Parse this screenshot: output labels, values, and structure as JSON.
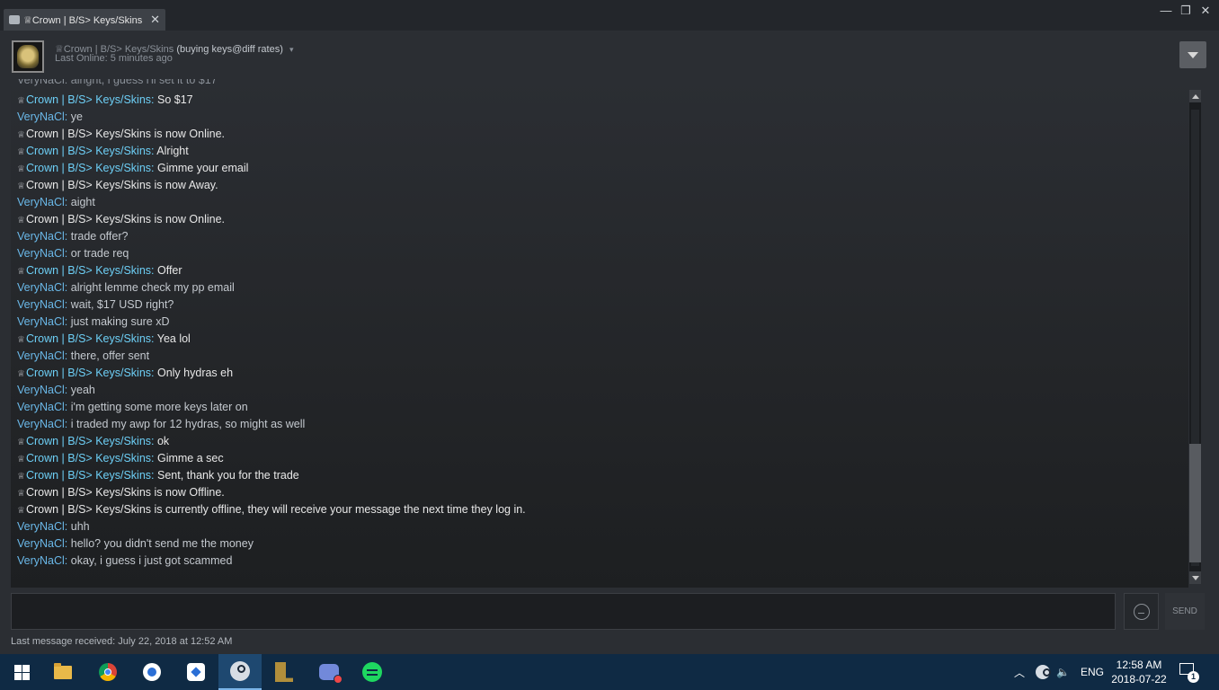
{
  "tab": {
    "title": "♕Crown | B/S> Keys/Skins",
    "close": "✕"
  },
  "window_controls": {
    "minimize": "—",
    "restore": "❐",
    "close": "✕"
  },
  "friend": {
    "name": "♕Crown | B/S> Keys/Skins",
    "extra": "(buying keys@diff rates)",
    "caret": "▾",
    "status": "Last Online: 5 minutes ago"
  },
  "chat": {
    "cut_line": "VeryNaCl: alright, i guess i'll set it to $17",
    "messages": [
      {
        "type": "friend",
        "name": "Crown | B/S> Keys/Skins",
        "text": "So $17"
      },
      {
        "type": "me",
        "name": "VeryNaCl",
        "text": "ye"
      },
      {
        "type": "status",
        "text": "Crown | B/S> Keys/Skins is now Online."
      },
      {
        "type": "friend",
        "name": "Crown | B/S> Keys/Skins",
        "text": "Alright"
      },
      {
        "type": "friend",
        "name": "Crown | B/S> Keys/Skins",
        "text": "Gimme your email"
      },
      {
        "type": "status",
        "text": "Crown | B/S> Keys/Skins is now Away."
      },
      {
        "type": "me",
        "name": "VeryNaCl",
        "text": "aight"
      },
      {
        "type": "status",
        "text": "Crown | B/S> Keys/Skins is now Online."
      },
      {
        "type": "me",
        "name": "VeryNaCl",
        "text": "trade offer?"
      },
      {
        "type": "me",
        "name": "VeryNaCl",
        "text": "or trade req"
      },
      {
        "type": "friend",
        "name": "Crown | B/S> Keys/Skins",
        "text": "Offer"
      },
      {
        "type": "me",
        "name": "VeryNaCl",
        "text": "alright lemme check my pp email"
      },
      {
        "type": "me",
        "name": "VeryNaCl",
        "text": "wait, $17 USD right?"
      },
      {
        "type": "me",
        "name": "VeryNaCl",
        "text": "just making sure xD"
      },
      {
        "type": "friend",
        "name": "Crown | B/S> Keys/Skins",
        "text": "Yea lol"
      },
      {
        "type": "me",
        "name": "VeryNaCl",
        "text": "there, offer sent"
      },
      {
        "type": "friend",
        "name": "Crown | B/S> Keys/Skins",
        "text": "Only hydras eh"
      },
      {
        "type": "me",
        "name": "VeryNaCl",
        "text": "yeah"
      },
      {
        "type": "me",
        "name": "VeryNaCl",
        "text": "i'm getting some more keys later on"
      },
      {
        "type": "me",
        "name": "VeryNaCl",
        "text": "i traded my awp for 12 hydras, so might as well"
      },
      {
        "type": "friend",
        "name": "Crown | B/S> Keys/Skins",
        "text": "ok"
      },
      {
        "type": "friend",
        "name": "Crown | B/S> Keys/Skins",
        "text": "Gimme a sec"
      },
      {
        "type": "friend",
        "name": "Crown | B/S> Keys/Skins",
        "text": "Sent, thank you for the trade"
      },
      {
        "type": "status",
        "text": "Crown | B/S> Keys/Skins is now Offline."
      },
      {
        "type": "status",
        "text": "Crown | B/S> Keys/Skins is currently offline, they will receive your message the next time they log in."
      },
      {
        "type": "me",
        "name": "VeryNaCl",
        "text": "uhh"
      },
      {
        "type": "me",
        "name": "VeryNaCl",
        "text": "hello? you didn't send me the money"
      },
      {
        "type": "me",
        "name": "VeryNaCl",
        "text": "okay, i guess i just got scammed"
      }
    ]
  },
  "composer": {
    "value": "",
    "send_label": "SEND"
  },
  "footer": {
    "last_message": "Last message received: July 22, 2018 at 12:52 AM"
  },
  "taskbar": {
    "apps": [
      "start",
      "file-explorer",
      "chrome",
      "app-blue-circle",
      "app-blue-square",
      "steam",
      "league-of-legends",
      "discord",
      "spotify"
    ],
    "tray": {
      "chevron": "︿",
      "speaker": "🔈",
      "language": "ENG"
    },
    "clock": {
      "time": "12:58 AM",
      "date": "2018-07-22"
    },
    "notification_count": "1"
  },
  "colors": {
    "friend_name": "#6dcff6",
    "my_name": "#6ab8e8",
    "background": "#2b2e33",
    "taskbar": "#0f2a44"
  }
}
